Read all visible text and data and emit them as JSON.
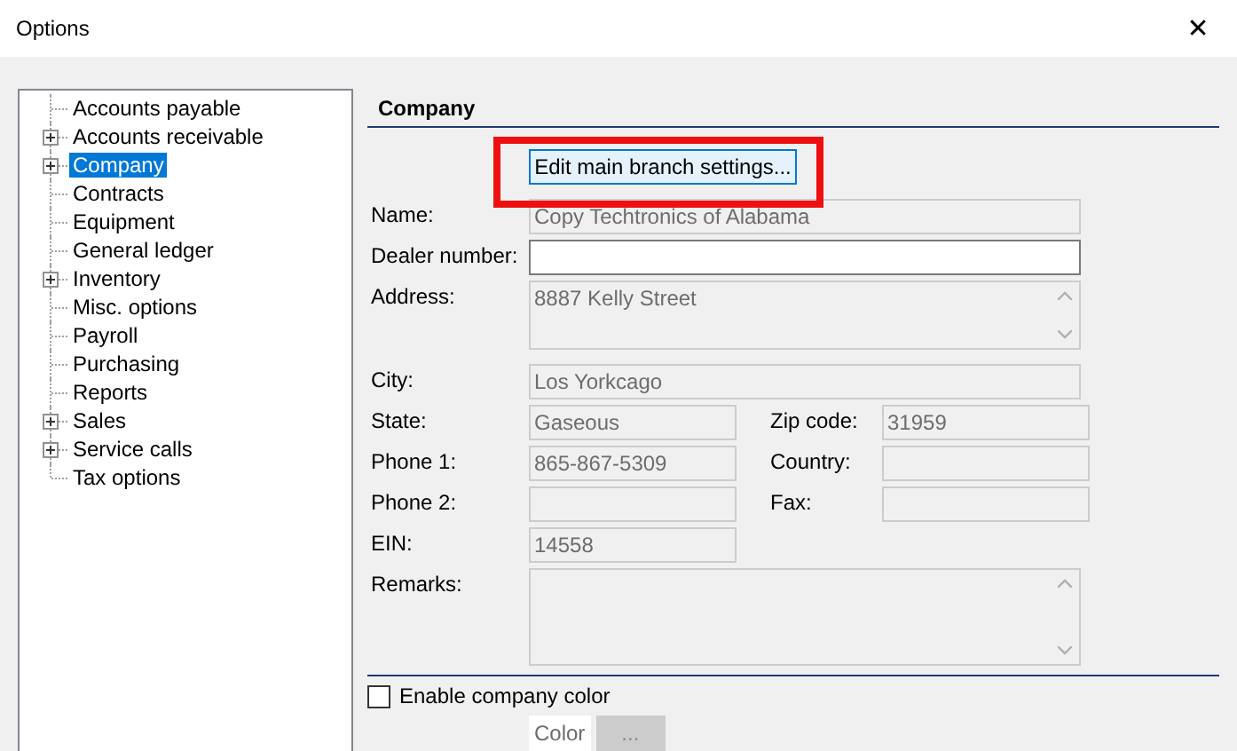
{
  "window": {
    "title": "Options",
    "close": "✕"
  },
  "tree": [
    {
      "label": "Accounts payable",
      "expandable": false,
      "selected": false
    },
    {
      "label": "Accounts receivable",
      "expandable": true,
      "selected": false
    },
    {
      "label": "Company",
      "expandable": true,
      "selected": true
    },
    {
      "label": "Contracts",
      "expandable": false,
      "selected": false
    },
    {
      "label": "Equipment",
      "expandable": false,
      "selected": false
    },
    {
      "label": "General ledger",
      "expandable": false,
      "selected": false
    },
    {
      "label": "Inventory",
      "expandable": true,
      "selected": false
    },
    {
      "label": "Misc. options",
      "expandable": false,
      "selected": false
    },
    {
      "label": "Payroll",
      "expandable": false,
      "selected": false
    },
    {
      "label": "Purchasing",
      "expandable": false,
      "selected": false
    },
    {
      "label": "Reports",
      "expandable": false,
      "selected": false
    },
    {
      "label": "Sales",
      "expandable": true,
      "selected": false
    },
    {
      "label": "Service calls",
      "expandable": true,
      "selected": false
    },
    {
      "label": "Tax options",
      "expandable": false,
      "selected": false
    }
  ],
  "section": {
    "title": "Company",
    "button": "Edit main branch settings...",
    "highlighted": true
  },
  "rows": [
    {
      "kind": "wide",
      "fields": [
        {
          "label": "Name:",
          "value": "Copy Techtronics of Alabama",
          "disabled": true
        }
      ]
    },
    {
      "kind": "wide",
      "fields": [
        {
          "label": "Dealer number:",
          "disabled": false
        }
      ]
    },
    {
      "kind": "memo",
      "fields": [
        {
          "label": "Address:",
          "value": "8887 Kelly Street",
          "disabled": true
        }
      ]
    },
    {
      "kind": "wide",
      "fields": [
        {
          "label": "City:",
          "value": "Los Yorkcago",
          "disabled": true
        }
      ]
    },
    {
      "kind": "pair",
      "fields": [
        {
          "label": "State:",
          "value": "Gaseous",
          "disabled": true
        },
        {
          "label": "Zip code:",
          "value": "31959",
          "disabled": true
        }
      ]
    },
    {
      "kind": "pair",
      "fields": [
        {
          "label": "Phone 1:",
          "value": "865-867-5309",
          "disabled": true
        },
        {
          "label": "Country:",
          "disabled": true
        }
      ]
    },
    {
      "kind": "pair",
      "fields": [
        {
          "label": "Phone 2:",
          "disabled": true
        },
        {
          "label": "Fax:",
          "disabled": true
        }
      ]
    },
    {
      "kind": "pair",
      "fields": [
        {
          "label": "EIN:",
          "value": "14558",
          "disabled": true
        }
      ]
    },
    {
      "kind": "memo",
      "fields": [
        {
          "label": "Remarks:",
          "disabled": true
        }
      ]
    }
  ],
  "color_option": {
    "label": "Enable company color",
    "checked": false,
    "color_label": "Color",
    "pick_button": "...",
    "pick_disabled": true
  }
}
